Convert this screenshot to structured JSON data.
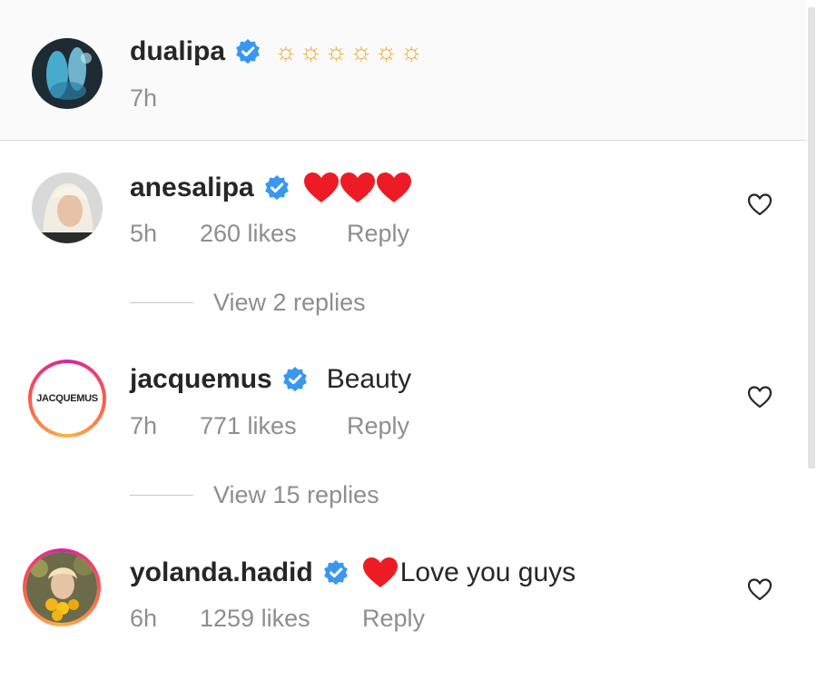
{
  "caption": {
    "username": "dualipa",
    "text": "☼☼☼☼☼☼",
    "time": "7h"
  },
  "comments": [
    {
      "username": "anesalipa",
      "text": "",
      "emoji": "heart",
      "time": "5h",
      "likes": "260 likes",
      "reply_label": "Reply",
      "view_replies": "View 2 replies"
    },
    {
      "username": "jacquemus",
      "text": "Beauty",
      "avatar_text": "JACQUEMUS",
      "time": "7h",
      "likes": "771 likes",
      "reply_label": "Reply",
      "view_replies": "View 15 replies"
    },
    {
      "username": "yolanda.hadid",
      "text": "Love you guys",
      "emoji": "heart",
      "time": "6h",
      "likes": "1259 likes",
      "reply_label": "Reply"
    }
  ],
  "colors": {
    "verified": "#3897f0",
    "heart": "#ed1c24",
    "muted_text": "#8e8e8e",
    "primary_text": "#262626",
    "story_ring_start": "#d6249f",
    "story_ring_end": "#fdb248"
  },
  "icons": {
    "verified": "verified-badge-icon",
    "like": "heart-outline-icon",
    "sun": "sun-emoji-icon",
    "heart_emoji": "red-heart-emoji-icon"
  }
}
